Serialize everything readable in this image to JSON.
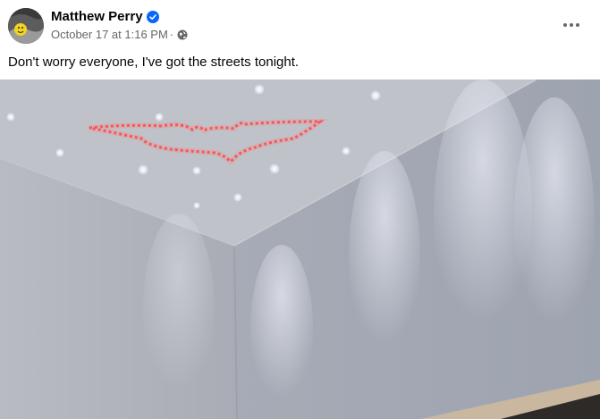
{
  "author": {
    "name": "Matthew Perry",
    "verified": true,
    "avatar_icon": "avatar-emoji-icon"
  },
  "post": {
    "timestamp": "October 17 at 1:16 PM",
    "separator": "·",
    "privacy_icon": "globe-icon",
    "text": "Don't worry everyone, I've got the streets tonight.",
    "more_icon": "more-horizontal-icon"
  },
  "colors": {
    "verified_blue": "#0866ff",
    "meta_gray": "#65676b",
    "text_dark": "#050505",
    "bat_light_red": "#ff3b3b"
  }
}
